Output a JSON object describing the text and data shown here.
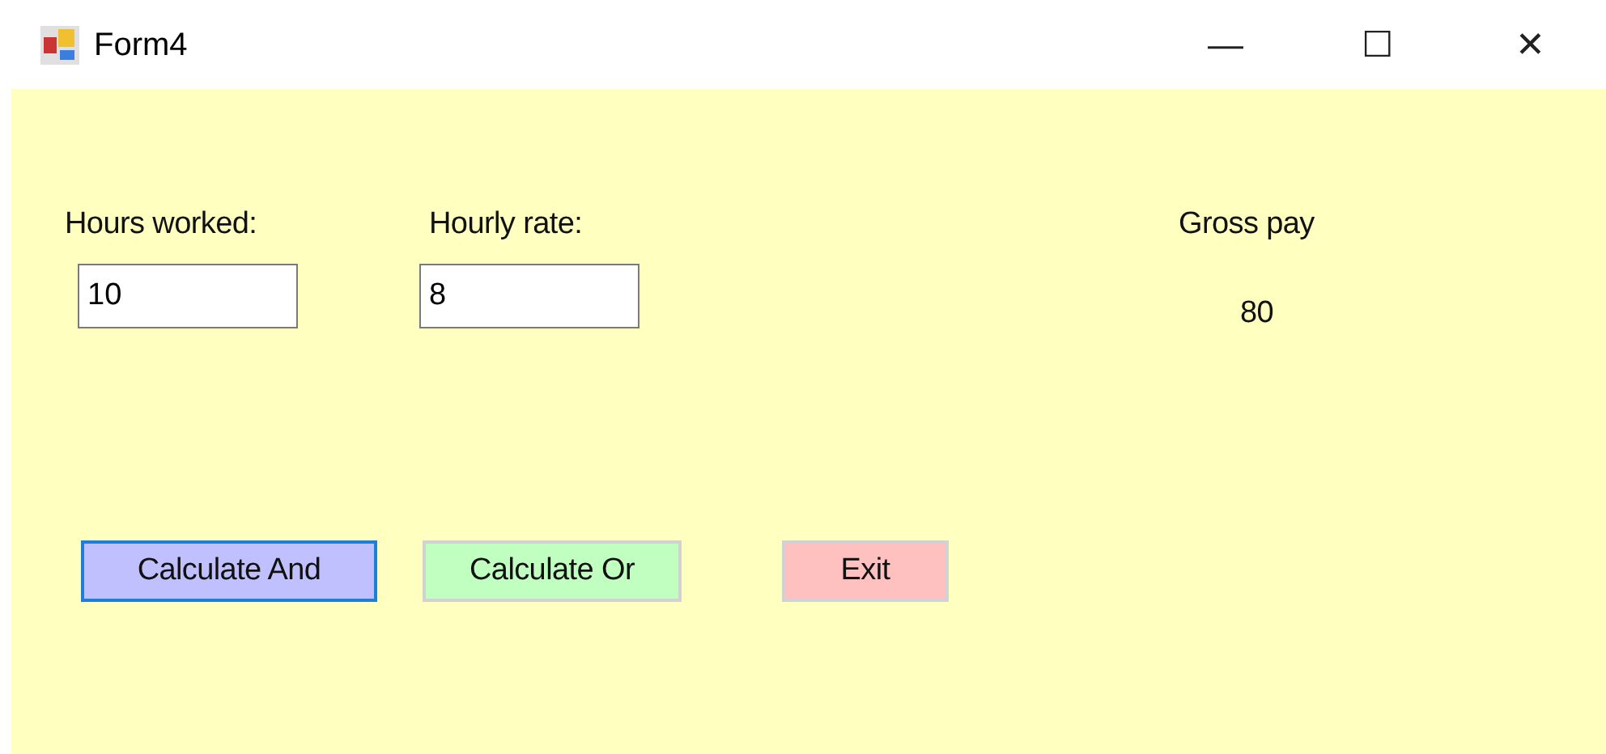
{
  "window": {
    "title": "Form4",
    "controls": [
      "—",
      "☐",
      "✕"
    ]
  },
  "fields": [
    {
      "label": "Hours worked:",
      "value": "10"
    },
    {
      "label": "Hourly rate:",
      "value": "8"
    }
  ],
  "result": {
    "label": "Gross pay",
    "value": "80"
  },
  "buttons": [
    {
      "label": "Calculate And",
      "color": "#c0c0ff",
      "focused": true
    },
    {
      "label": "Calculate Or",
      "color": "#c0ffc0",
      "focused": false
    },
    {
      "label": "Exit",
      "color": "#ffc0c0",
      "focused": false
    }
  ]
}
